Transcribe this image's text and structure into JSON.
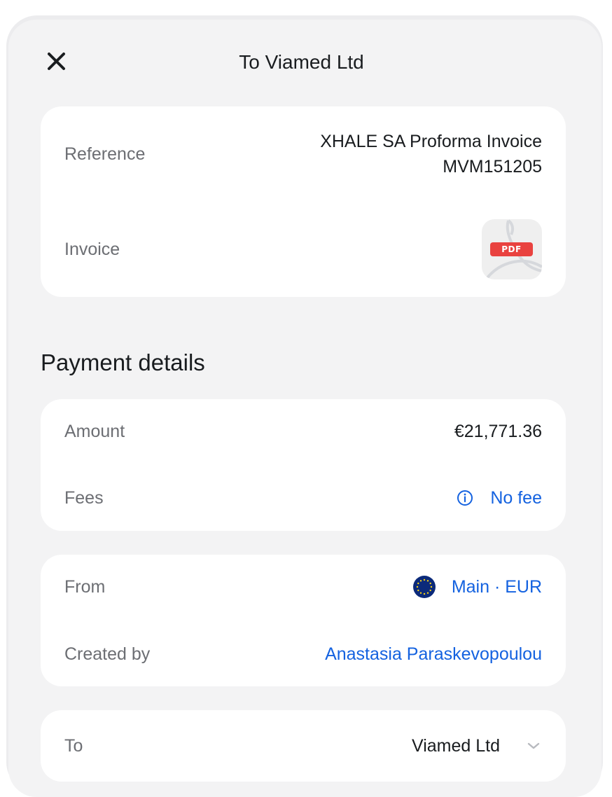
{
  "header": {
    "title": "To Viamed Ltd",
    "close_icon": "close-icon"
  },
  "reference_card": {
    "reference_label": "Reference",
    "reference_value_line1": "XHALE SA Proforma Invoice",
    "reference_value_line2": "MVM151205",
    "invoice_label": "Invoice",
    "invoice_badge": "PDF",
    "invoice_icon": "pdf-file-icon"
  },
  "payment_details": {
    "section_title": "Payment details",
    "amount_label": "Amount",
    "amount_value": "€21,771.36",
    "fees_label": "Fees",
    "fees_value": "No fee",
    "fees_icon": "info-icon"
  },
  "source_card": {
    "from_label": "From",
    "from_value": "Main · EUR",
    "from_icon": "eu-flag-icon",
    "created_by_label": "Created by",
    "created_by_value": "Anastasia Paraskevopoulou"
  },
  "recipient_card": {
    "to_label": "To",
    "to_value": "Viamed Ltd",
    "to_icon": "chevron-down-icon"
  },
  "colors": {
    "panel_background": "#f3f3f4",
    "card_background": "#ffffff",
    "link_blue": "#1462e0",
    "label_gray": "#6c6e73",
    "pdf_red": "#e9423f",
    "eu_blue": "#0b2a7a"
  }
}
